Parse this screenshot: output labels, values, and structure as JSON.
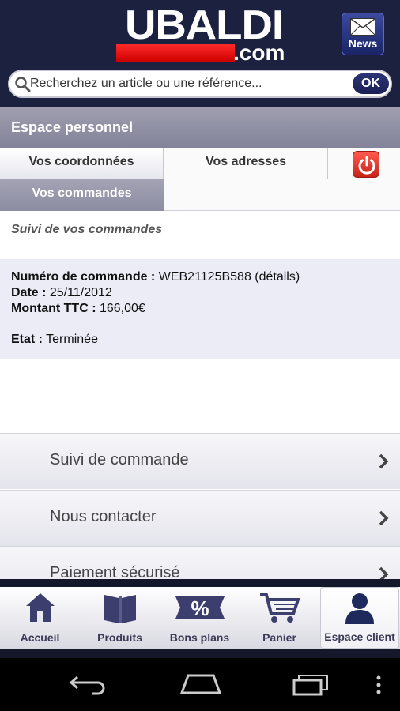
{
  "header": {
    "logo_main": "UBALDI",
    "logo_suffix": ".com",
    "news_label": "News"
  },
  "search": {
    "placeholder": "Recherchez un article ou une référence...",
    "ok_label": "OK"
  },
  "section_title": "Espace personnel",
  "tabs": {
    "coordonnees": "Vos coordonnées",
    "adresses": "Vos adresses",
    "commandes": "Vos commandes"
  },
  "orders": {
    "heading": "Suivi de vos commandes",
    "number_label": "Numéro de commande :",
    "number_value": "WEB21125B588 (détails)",
    "date_label": "Date :",
    "date_value": "25/11/2012",
    "amount_label": "Montant TTC :",
    "amount_value": "166,00€",
    "state_label": "Etat :",
    "state_value": "Terminée"
  },
  "menu": {
    "items": [
      {
        "label": "Suivi de commande"
      },
      {
        "label": "Nous contacter"
      },
      {
        "label": "Paiement sécurisé"
      }
    ]
  },
  "tabbar": {
    "items": [
      {
        "label": "Accueil",
        "icon": "home-icon"
      },
      {
        "label": "Produits",
        "icon": "book-icon"
      },
      {
        "label": "Bons plans",
        "icon": "percent-icon"
      },
      {
        "label": "Panier",
        "icon": "cart-icon"
      },
      {
        "label": "Espace client",
        "icon": "user-icon"
      }
    ],
    "active": "Espace client"
  },
  "colors": {
    "header_bg": "#1c2140",
    "brand_red": "#e10000",
    "section_bg": "#8f8fa4",
    "order_card_bg": "#ececf7"
  }
}
